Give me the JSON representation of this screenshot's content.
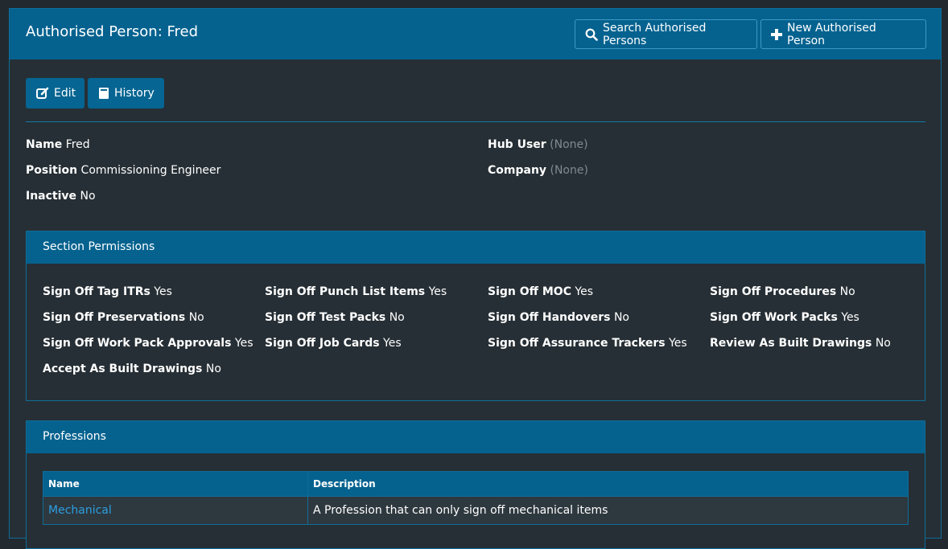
{
  "header": {
    "title": "Authorised Person: Fred",
    "search_label": "Search Authorised Persons",
    "new_label": "New Authorised Person"
  },
  "actions": {
    "edit_label": "Edit",
    "history_label": "History"
  },
  "details": {
    "name_label": "Name",
    "name_value": "Fred",
    "position_label": "Position",
    "position_value": "Commissioning Engineer",
    "inactive_label": "Inactive",
    "inactive_value": "No",
    "hub_user_label": "Hub User",
    "hub_user_value": "(None)",
    "company_label": "Company",
    "company_value": "(None)"
  },
  "permissions": {
    "title": "Section Permissions",
    "items": [
      {
        "label": "Sign Off Tag ITRs",
        "value": "Yes"
      },
      {
        "label": "Sign Off Punch List Items",
        "value": "Yes"
      },
      {
        "label": "Sign Off MOC",
        "value": "Yes"
      },
      {
        "label": "Sign Off Procedures",
        "value": "No"
      },
      {
        "label": "Sign Off Preservations",
        "value": "No"
      },
      {
        "label": "Sign Off Test Packs",
        "value": "No"
      },
      {
        "label": "Sign Off Handovers",
        "value": "No"
      },
      {
        "label": "Sign Off Work Packs",
        "value": "Yes"
      },
      {
        "label": "Sign Off Work Pack Approvals",
        "value": "Yes"
      },
      {
        "label": "Sign Off Job Cards",
        "value": "Yes"
      },
      {
        "label": "Sign Off Assurance Trackers",
        "value": "Yes"
      },
      {
        "label": "Review As Built Drawings",
        "value": "No"
      },
      {
        "label": "Accept As Built Drawings",
        "value": "No"
      }
    ]
  },
  "professions": {
    "title": "Professions",
    "columns": [
      "Name",
      "Description"
    ],
    "rows": [
      {
        "name": "Mechanical",
        "description": "A Profession that can only sign off mechanical items"
      }
    ]
  },
  "icons": {
    "search": "search-icon",
    "new": "plus-icon",
    "edit": "edit-icon",
    "history": "book-icon"
  },
  "colors": {
    "background": "#22292f",
    "panel": "#262f35",
    "header": "#05628f",
    "border": "#0f6d99",
    "link": "#2b9fe0",
    "muted": "#7f8a90"
  }
}
